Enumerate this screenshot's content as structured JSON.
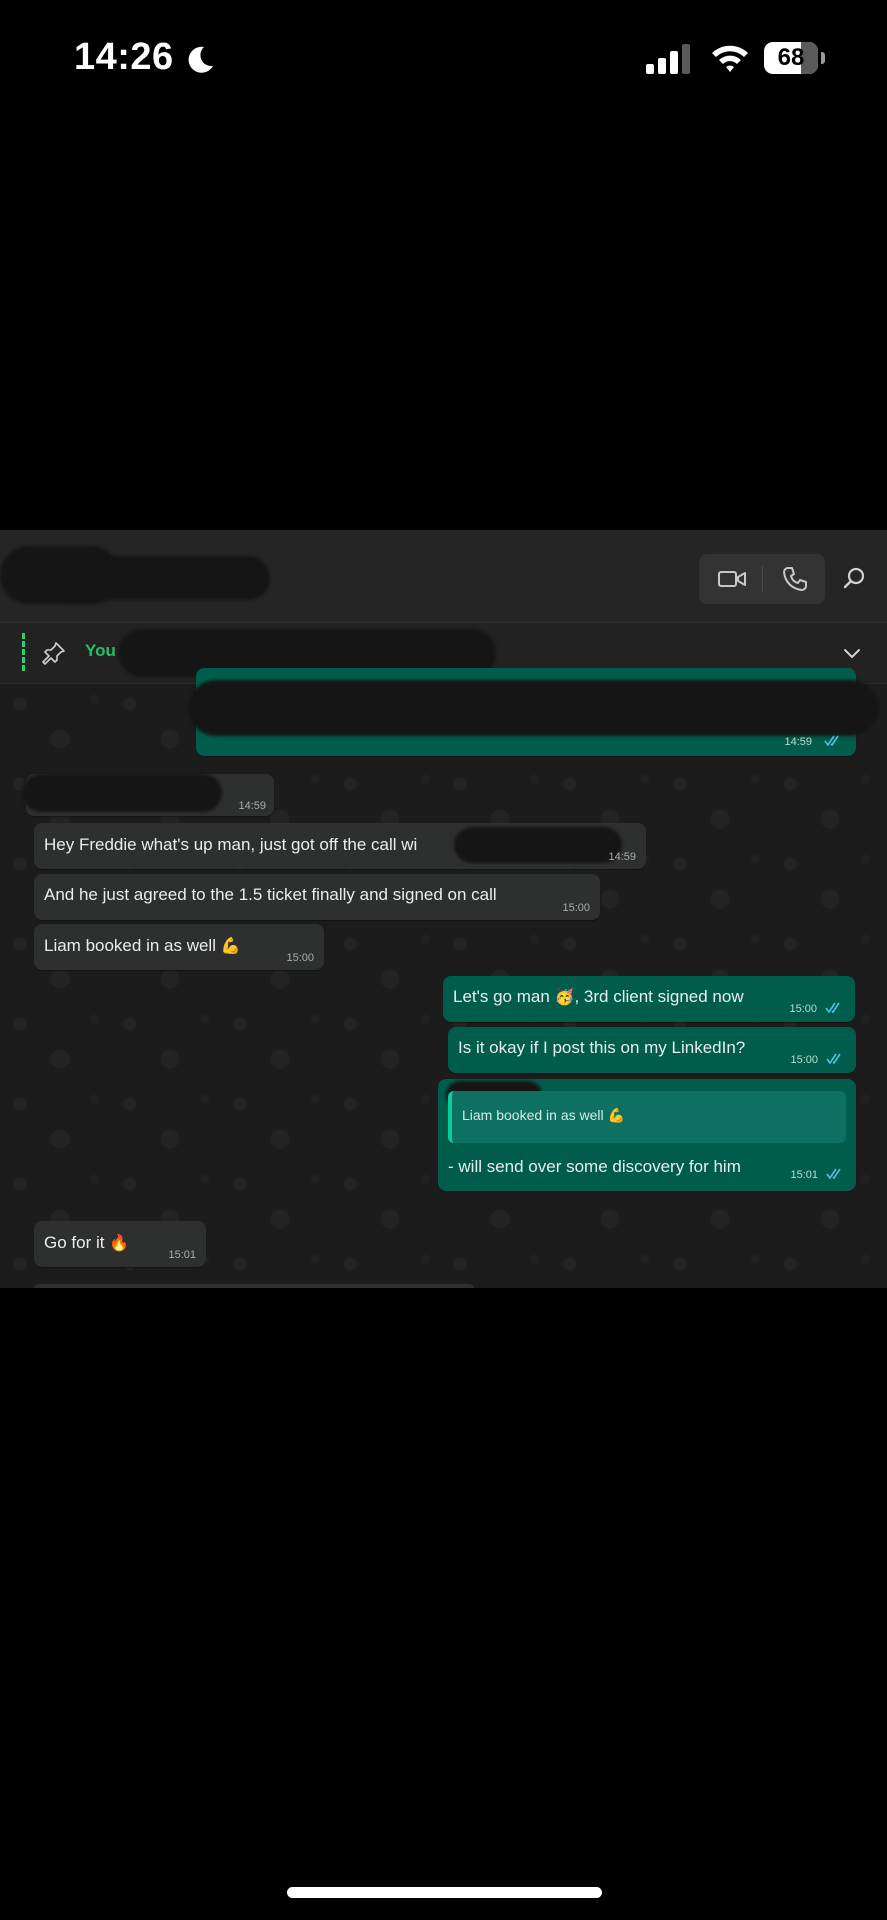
{
  "status_bar": {
    "time": "14:26",
    "battery_percent": "68",
    "battery_level": 0.68
  },
  "chat": {
    "pinned_preview": "You",
    "messages": [
      {
        "id": "m1",
        "direction": "outgoing",
        "text": "",
        "time": "14:59",
        "redacted": true
      },
      {
        "id": "m2",
        "direction": "incoming",
        "text": "",
        "time": "14:59",
        "redacted": true
      },
      {
        "id": "m3",
        "direction": "incoming",
        "text": "Hey Freddie what's up man, just got off the call wi",
        "time": "14:59"
      },
      {
        "id": "m4",
        "direction": "incoming",
        "text": "And he just agreed to the 1.5 ticket finally and signed on call",
        "time": "15:00"
      },
      {
        "id": "m5",
        "direction": "incoming",
        "text": "Liam booked in as well",
        "emoji": "💪",
        "time": "15:00"
      },
      {
        "id": "m6",
        "direction": "outgoing",
        "text_before": "Let's go man",
        "emoji": "🥳",
        "text_after": ", 3rd client signed now",
        "time": "15:00"
      },
      {
        "id": "m7",
        "direction": "outgoing",
        "text": "Is it okay if I post this on my LinkedIn?",
        "time": "15:00"
      },
      {
        "id": "m8",
        "direction": "outgoing",
        "quote": "Liam booked in as well",
        "quote_emoji": "💪",
        "text": "- will send over some discovery for him",
        "time": "15:01"
      },
      {
        "id": "m9",
        "direction": "incoming",
        "text": "Go for it",
        "emoji": "🔥",
        "time": "15:01"
      }
    ]
  },
  "colors": {
    "incoming_bubble": "#2e2f2f",
    "outgoing_bubble": "#005c4b",
    "accent_green": "#21c063",
    "read_tick": "#53bdeb"
  },
  "icons": {
    "moon": "moon-icon",
    "signal": "cellular-signal-icon",
    "wifi": "wifi-icon",
    "video": "video-call-icon",
    "phone": "voice-call-icon",
    "search": "search-icon",
    "pin": "pin-icon",
    "chevron": "chevron-down-icon",
    "ticks": "double-check-icon"
  }
}
